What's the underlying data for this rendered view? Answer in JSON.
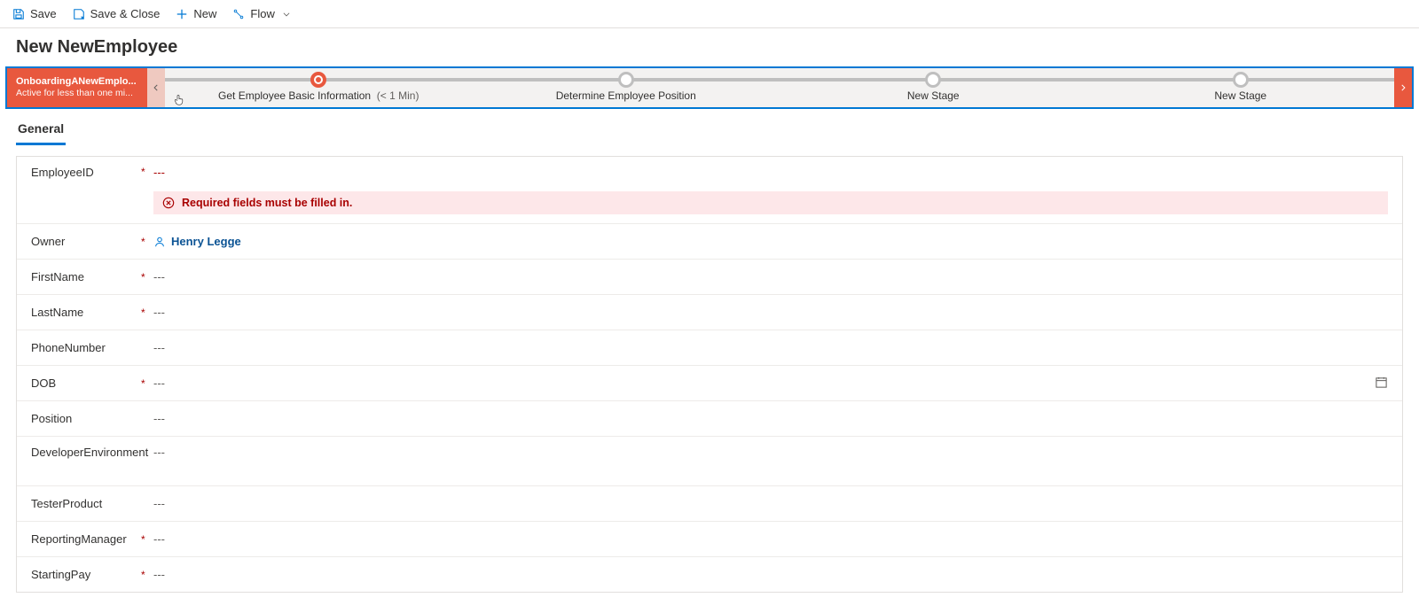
{
  "commandbar": {
    "save": "Save",
    "save_close": "Save & Close",
    "new": "New",
    "flow": "Flow"
  },
  "header": {
    "title": "New NewEmployee"
  },
  "bpf": {
    "process_name": "OnboardingANewEmplo...",
    "process_sub": "Active for less than one mi...",
    "stages": [
      {
        "label": "Get Employee Basic Information",
        "duration": "(< 1 Min)",
        "active": true
      },
      {
        "label": "Determine Employee Position",
        "duration": "",
        "active": false
      },
      {
        "label": "New Stage",
        "duration": "",
        "active": false
      },
      {
        "label": "New Stage",
        "duration": "",
        "active": false
      }
    ]
  },
  "tabs": {
    "general": "General"
  },
  "form": {
    "empty": "---",
    "error_msg": "Required fields must be filled in.",
    "owner_value": "Henry Legge",
    "fields": {
      "employee_id": "EmployeeID",
      "owner": "Owner",
      "first_name": "FirstName",
      "last_name": "LastName",
      "phone_number": "PhoneNumber",
      "dob": "DOB",
      "position": "Position",
      "dev_env": "DeveloperEnvironment",
      "tester_product": "TesterProduct",
      "reporting_manager": "ReportingManager",
      "starting_pay": "StartingPay"
    }
  }
}
